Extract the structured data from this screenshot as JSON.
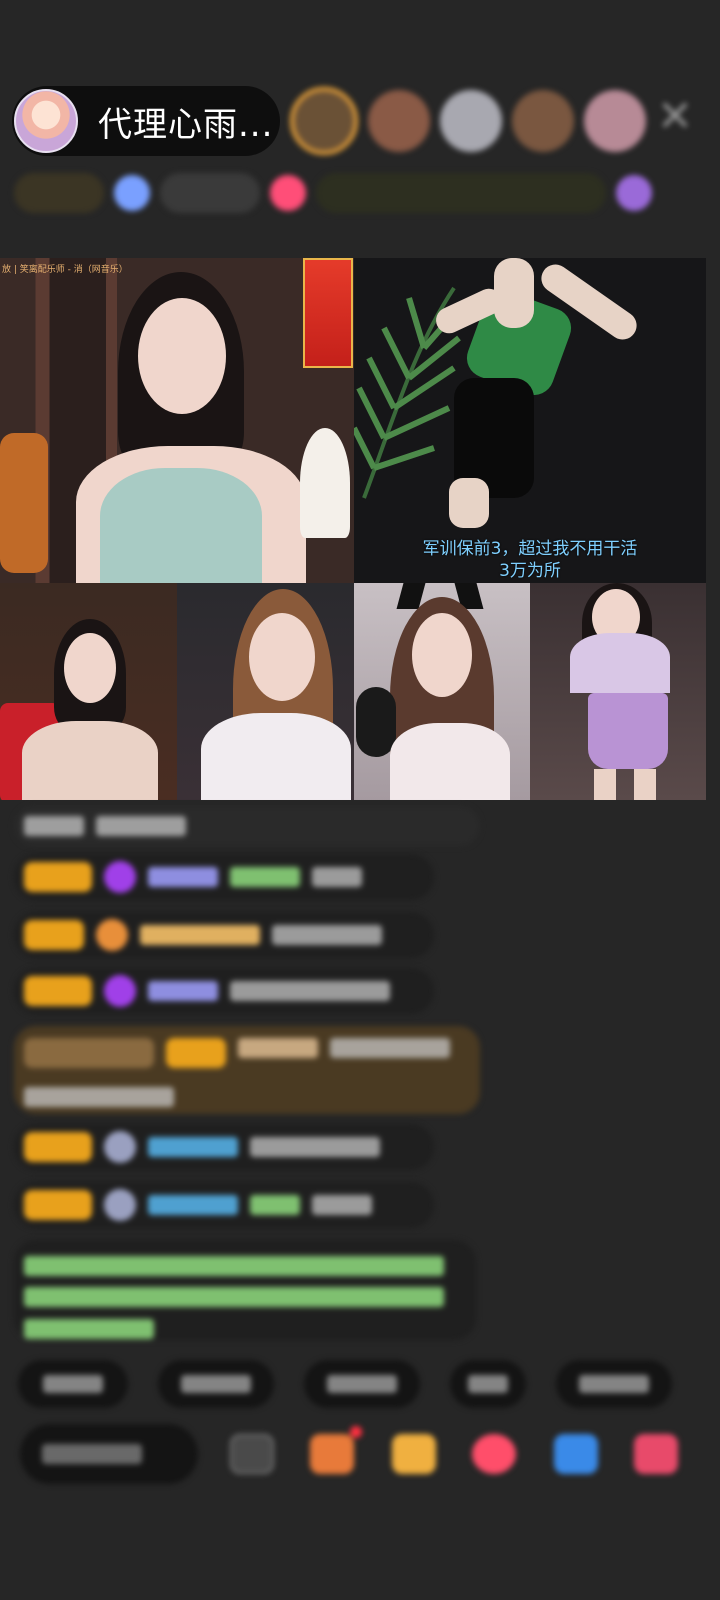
{
  "header": {
    "host_name": "代理心雨...",
    "close_icon": "close-icon"
  },
  "video_grid": {
    "tile1_label": "放 | 笑离配乐师 - 消（网音乐）",
    "tile2_caption_line1": "军训保前3，超过我不用干活",
    "tile2_caption_line2": "3万为所"
  },
  "colors": {
    "background": "#262626",
    "badge": "#e8a11c",
    "caption": "#7fd0ff",
    "chat_bubble": "#1f1f1f"
  }
}
